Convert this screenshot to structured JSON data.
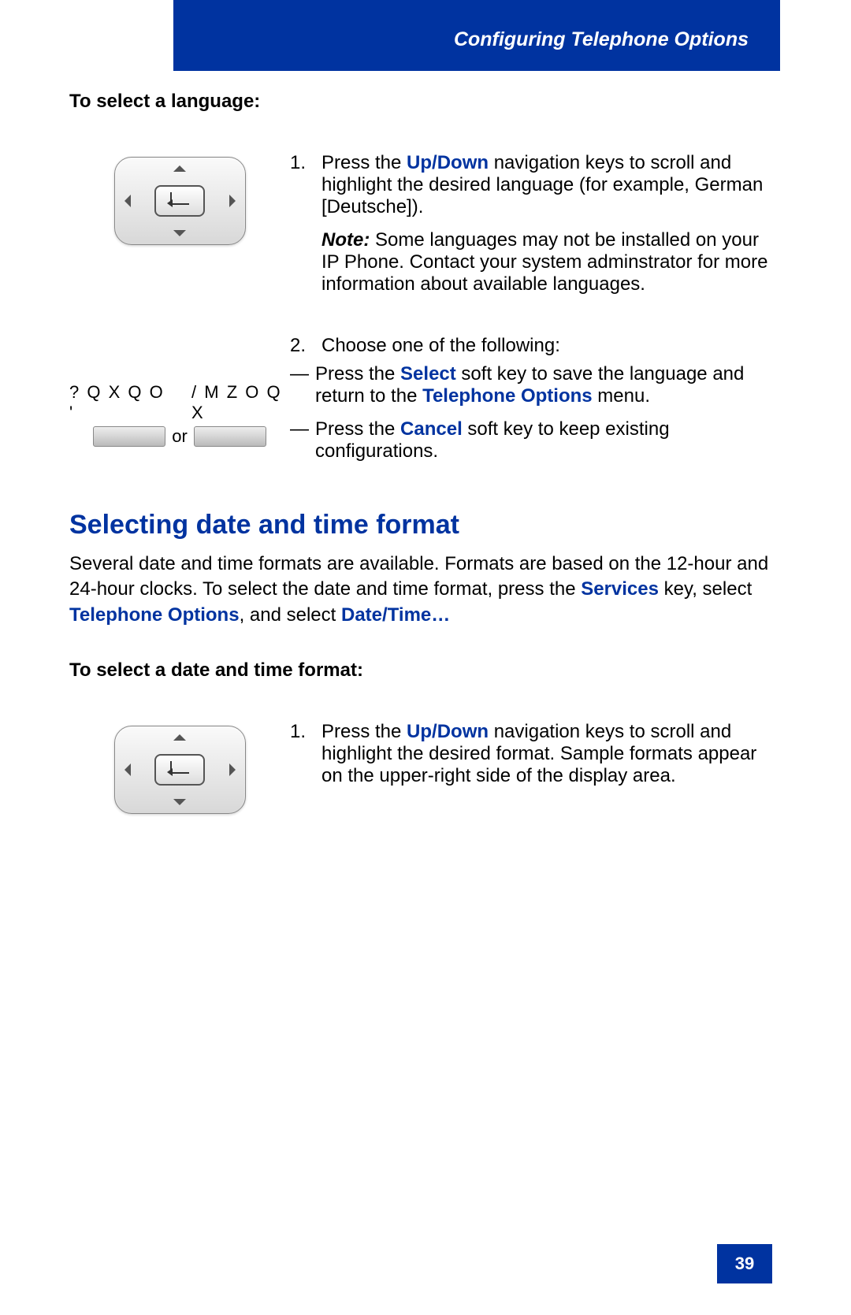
{
  "header": {
    "title": "Configuring Telephone Options"
  },
  "lang_section": {
    "heading": "To select a language:",
    "step1_num": "1.",
    "step1_a": "Press the ",
    "step1_link": "Up/Down",
    "step1_b": " navigation keys to scroll and highlight the desired language (for example, German [Deutsche]).",
    "note_label": "Note:",
    "note_body": " Some languages may not be installed on your IP Phone. Contact your system adminstrator for more information about available languages.",
    "softkey_left_label": "? Q X Q O '",
    "softkey_or": "or",
    "softkey_right_label": "/ M Z O Q X",
    "step2_num": "2.",
    "step2_intro": "Choose one of the following:",
    "dash": "—",
    "b1_a": "Press the ",
    "b1_link1": "Select",
    "b1_b": " soft key to save the language and return to the ",
    "b1_link2": "Telephone Options",
    "b1_c": " menu.",
    "b2_a": "Press the ",
    "b2_link": "Cancel",
    "b2_b": " soft key to keep existing configurations."
  },
  "dt_section": {
    "title": "Selecting date and time format",
    "p_a": "Several date and time formats are available. Formats are based on the 12-hour and 24-hour clocks. To select the date and time format, press the ",
    "p_link1": "Services",
    "p_b": " key, select ",
    "p_link2": "Telephone Options",
    "p_c": ", and select ",
    "p_link3": "Date/Time…",
    "heading": "To select a date and time format:",
    "step1_num": "1.",
    "step1_a": "Press the ",
    "step1_link": "Up/Down",
    "step1_b": " navigation keys to scroll and highlight the desired format. Sample formats appear on the upper-right side of the display area."
  },
  "page_number": "39"
}
